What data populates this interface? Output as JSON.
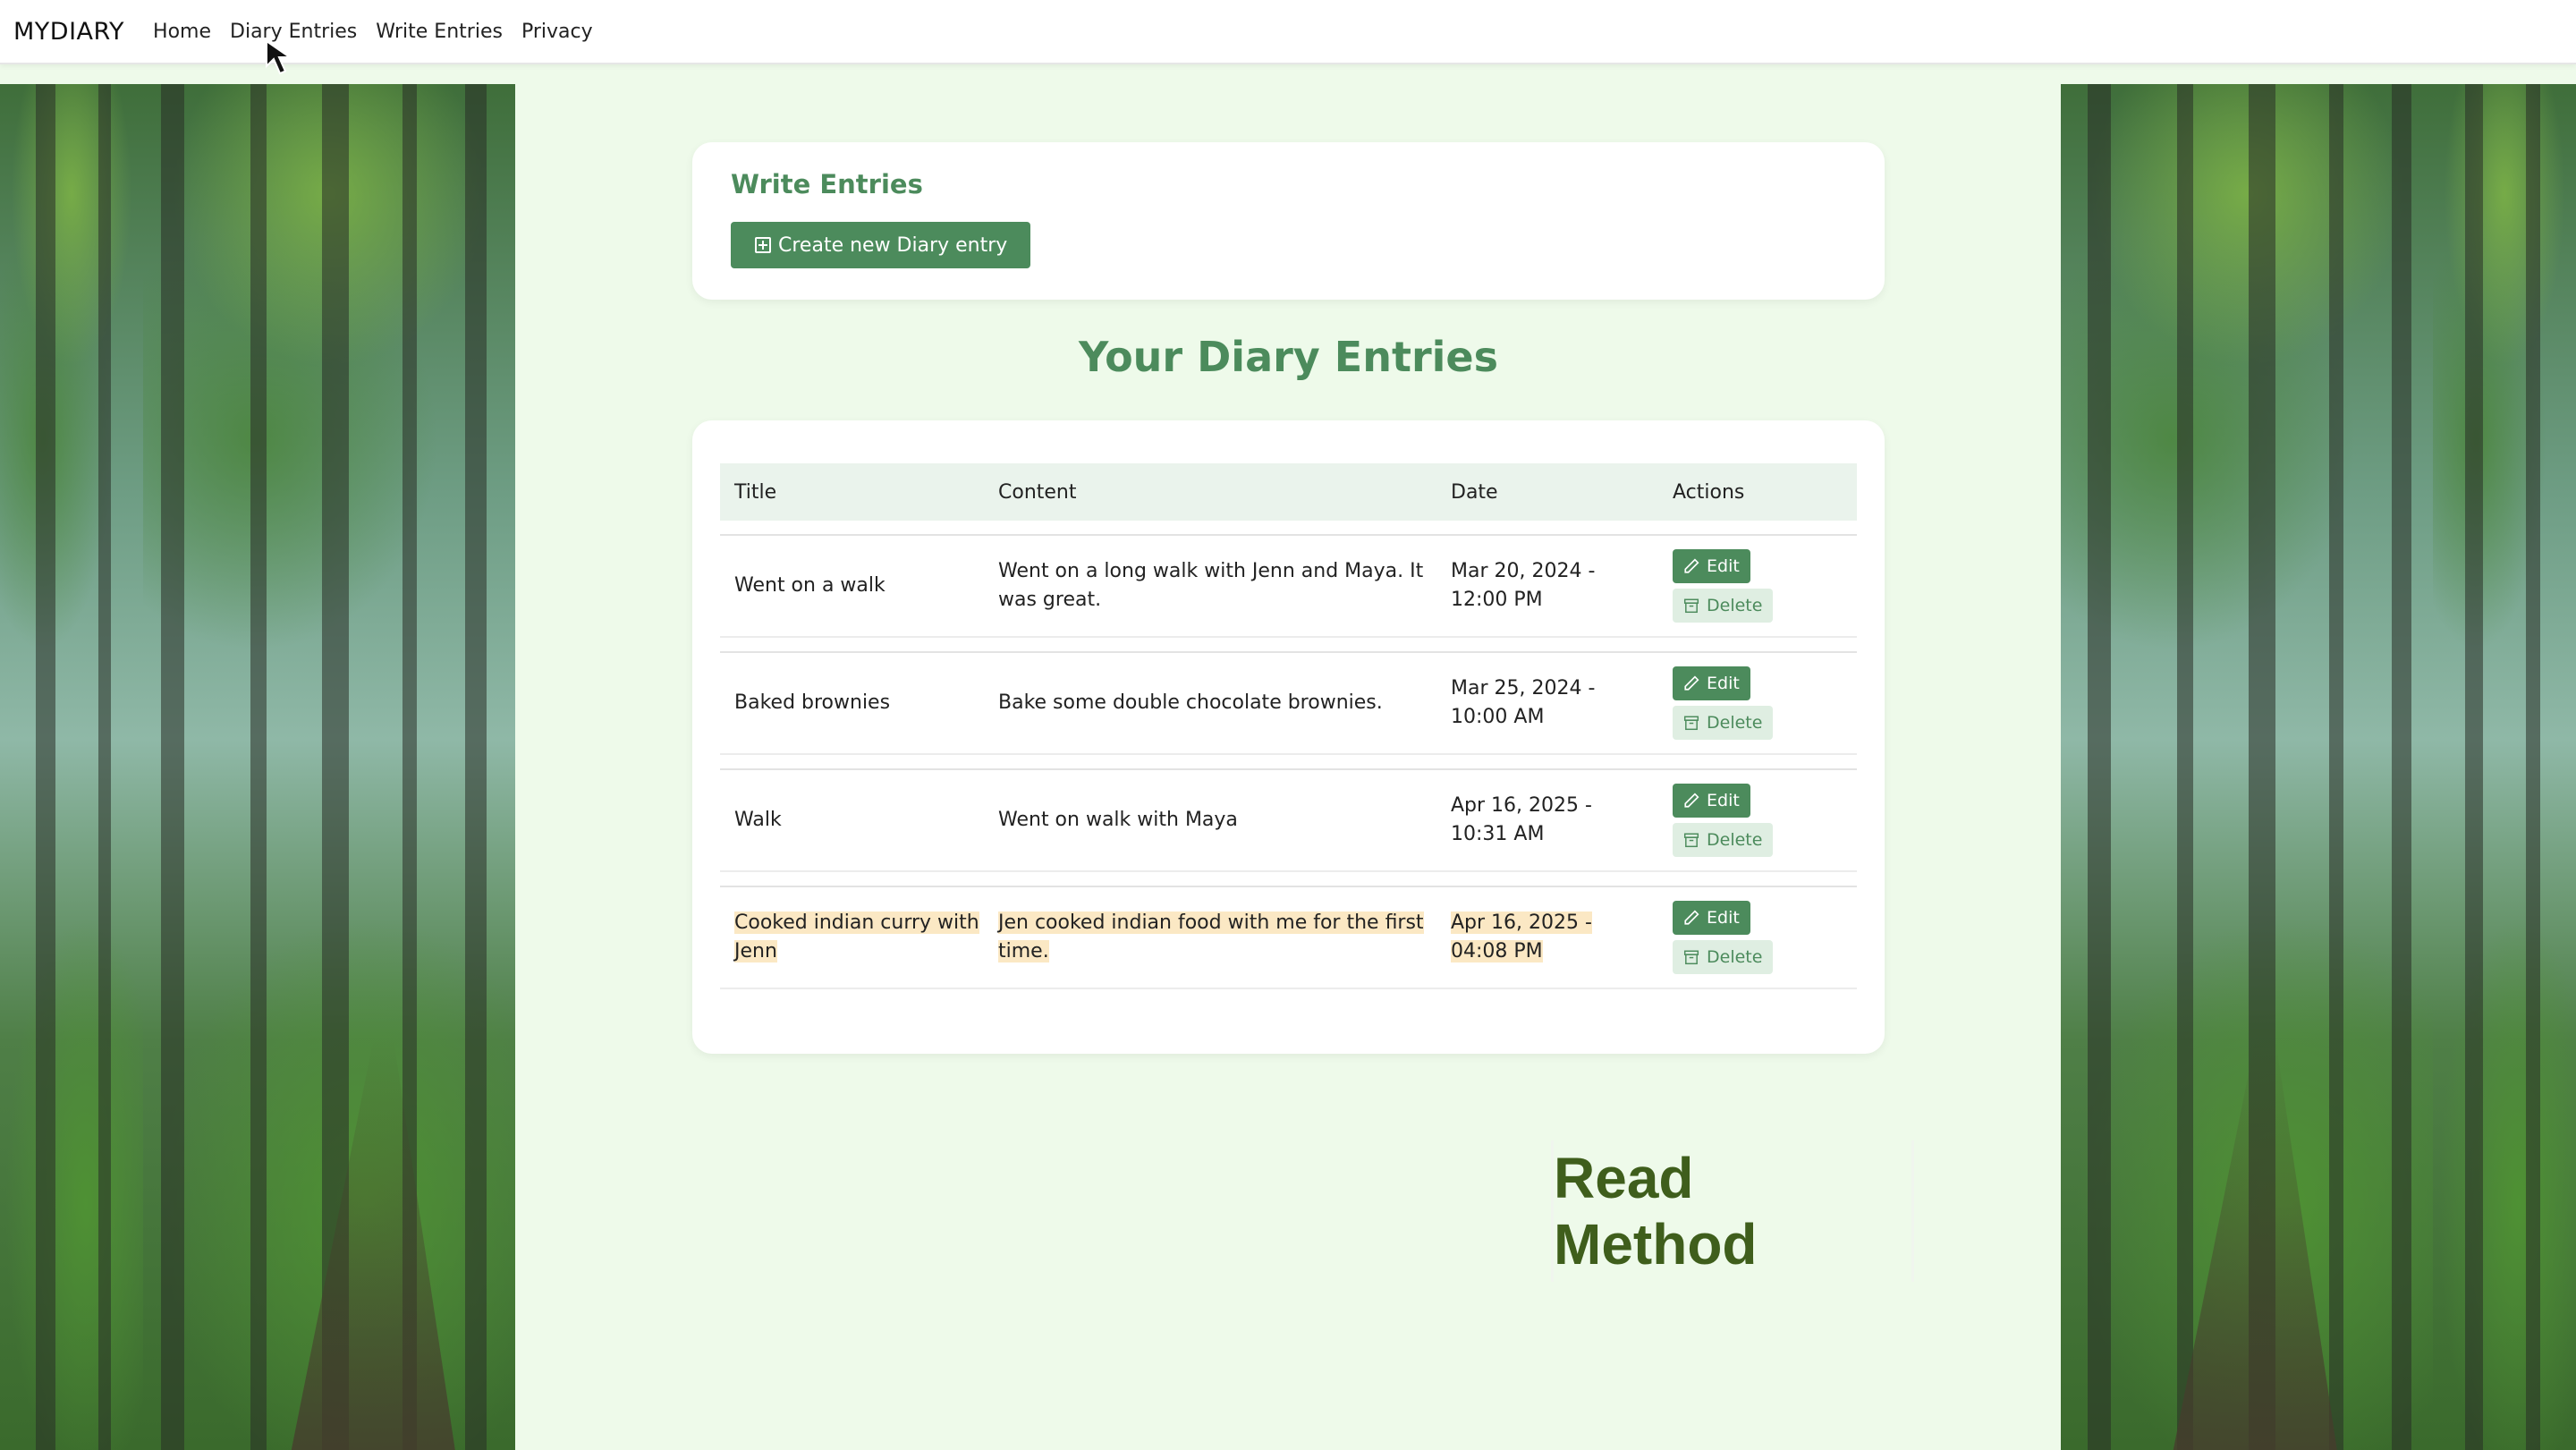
{
  "nav": {
    "brand": "MYDIARY",
    "links": [
      "Home",
      "Diary Entries",
      "Write Entries",
      "Privacy"
    ]
  },
  "write_section": {
    "title": "Write Entries",
    "create_button": "Create new Diary entry"
  },
  "entries_section": {
    "title": "Your Diary Entries",
    "columns": [
      "Title",
      "Content",
      "Date",
      "Actions"
    ],
    "rows": [
      {
        "title": "Went on a walk",
        "content": "Went on a long walk with Jenn and Maya. It was great.",
        "date": "Mar 20, 2024 - 12:00 PM",
        "edit": "Edit",
        "delete": "Delete",
        "highlighted": false
      },
      {
        "title": "Baked brownies",
        "content": "Bake some double chocolate brownies.",
        "date": "Mar 25, 2024 - 10:00 AM",
        "edit": "Edit",
        "delete": "Delete",
        "highlighted": false
      },
      {
        "title": "Walk",
        "content": "Went on walk with Maya",
        "date": "Apr 16, 2025 - 10:31 AM",
        "edit": "Edit",
        "delete": "Delete",
        "highlighted": false
      },
      {
        "title": "Cooked indian curry with Jenn",
        "content": "Jen cooked indian food with me for the first time.",
        "date": "Apr 16, 2025 - 04:08 PM",
        "edit": "Edit",
        "delete": "Delete",
        "highlighted": true
      }
    ]
  },
  "overlay_label": "Read Method",
  "colors": {
    "accent": "#4c8b5c",
    "page_bg": "#eefaea",
    "highlight": "#fbe8c4",
    "overlay_text": "#3f5e1c"
  },
  "icons": [
    "plus-square-icon",
    "pencil-icon",
    "archive-icon",
    "mouse-cursor-icon"
  ]
}
